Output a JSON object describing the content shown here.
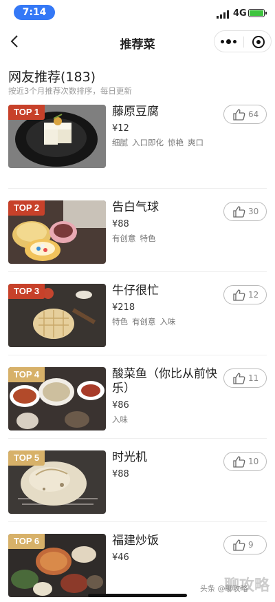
{
  "status": {
    "time": "7:14",
    "network": "4G"
  },
  "nav": {
    "title": "推荐菜"
  },
  "section": {
    "title": "网友推荐(183)",
    "subtitle": "按近3个月推荐次数排序，每日更新"
  },
  "items": [
    {
      "rank": "TOP 1",
      "name": "藤原豆腐",
      "price": "¥12",
      "tags": [
        "细腻",
        "入口即化",
        "惊艳",
        "爽口"
      ],
      "likes": "64"
    },
    {
      "rank": "TOP 2",
      "name": "告白气球",
      "price": "¥88",
      "tags": [
        "有创意",
        "特色"
      ],
      "likes": "30"
    },
    {
      "rank": "TOP 3",
      "name": "牛仔很忙",
      "price": "¥218",
      "tags": [
        "特色",
        "有创意",
        "入味"
      ],
      "likes": "12"
    },
    {
      "rank": "TOP 4",
      "name": "酸菜鱼（你比从前快乐）",
      "price": "¥86",
      "tags": [
        "入味"
      ],
      "likes": "11"
    },
    {
      "rank": "TOP 5",
      "name": "时光机",
      "price": "¥88",
      "tags": [],
      "likes": "10"
    },
    {
      "rank": "TOP 6",
      "name": "福建炒饭",
      "price": "¥46",
      "tags": [],
      "likes": "9"
    }
  ],
  "watermark": {
    "text": "头条 @聊攻略",
    "big": "聊攻略"
  },
  "colors": {
    "badge_top3": "#c7412a",
    "badge_rest": "#d7b169",
    "status_pill": "#3478f6"
  }
}
